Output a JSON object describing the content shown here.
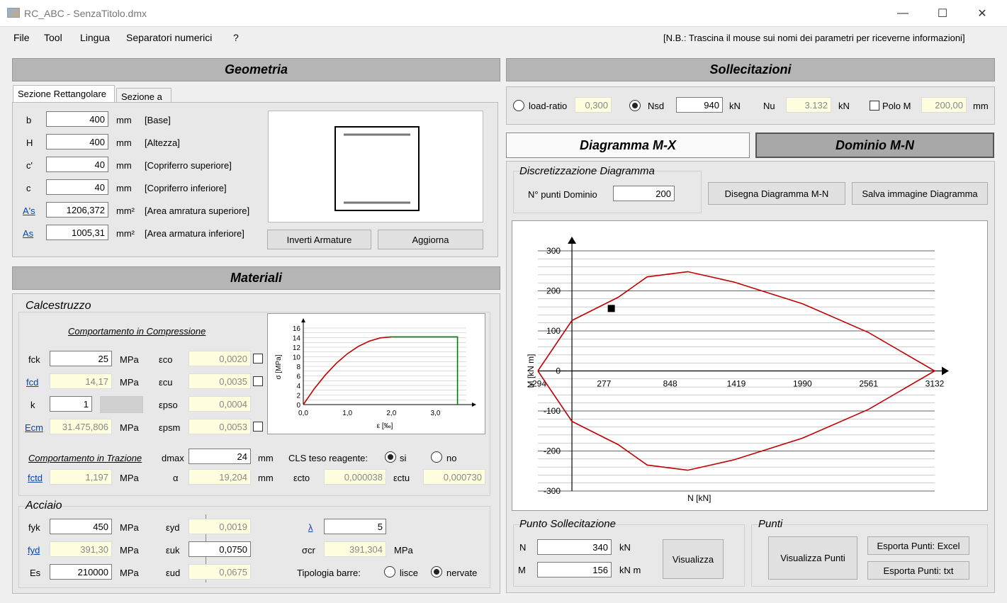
{
  "window": {
    "title": "RC_ABC - SenzaTitolo.dmx",
    "minimize": "—",
    "maximize": "☐",
    "close": "✕"
  },
  "menu": {
    "items": [
      "File",
      "Tool",
      "Lingua",
      "Separatori numerici",
      "?"
    ],
    "note": "[N.B.: Trascina il mouse sui nomi dei parametri per riceverne informazioni]"
  },
  "geometria": {
    "title": "Geometria",
    "tabs": [
      "Sezione Rettangolare",
      "Sezione a T"
    ],
    "rows": [
      {
        "label": "b",
        "value": "400",
        "unit": "mm",
        "desc": "[Base]",
        "link": false
      },
      {
        "label": "H",
        "value": "400",
        "unit": "mm",
        "desc": "[Altezza]",
        "link": false
      },
      {
        "label": "c'",
        "value": "40",
        "unit": "mm",
        "desc": "[Copriferro superiore]",
        "link": false
      },
      {
        "label": "c",
        "value": "40",
        "unit": "mm",
        "desc": "[Copriferro inferiore]",
        "link": false
      },
      {
        "label": "A's",
        "value": "1206,372",
        "unit": "mm²",
        "desc": "[Area amratura superiore]",
        "link": true
      },
      {
        "label": "As",
        "value": "1005,31",
        "unit": "mm²",
        "desc": "[Area armatura inferiore]",
        "link": true
      }
    ],
    "btn_inverti": "Inverti Armature",
    "btn_aggiorna": "Aggiorna"
  },
  "materiali": {
    "title": "Materiali",
    "calcestruzzo": "Calcestruzzo",
    "comp_title": "Comportamento in Compressione",
    "fck": {
      "label": "fck",
      "value": "25",
      "unit": "MPa"
    },
    "fcd": {
      "label": "fcd",
      "value": "14,17",
      "unit": "MPa"
    },
    "k": {
      "label": "k",
      "value": "1"
    },
    "ecm": {
      "label": "Ecm",
      "value": "31.475,806",
      "unit": "MPa"
    },
    "eco": {
      "label": "εco",
      "value": "0,0020"
    },
    "ecu": {
      "label": "εcu",
      "value": "0,0035"
    },
    "epso": {
      "label": "εpso",
      "value": "0,0004"
    },
    "epsm": {
      "label": "εpsm",
      "value": "0,0053"
    },
    "traz_title": "Comportamento in Trazione",
    "dmax": {
      "label": "dmax",
      "value": "24",
      "unit": "mm"
    },
    "cls_teso": {
      "label": "CLS teso reagente:",
      "si": "si",
      "no": "no"
    },
    "fctd": {
      "label": "fctd",
      "value": "1,197",
      "unit": "MPa"
    },
    "alpha": {
      "label": "α",
      "value": "19,204",
      "unit": "mm"
    },
    "ecto": {
      "label": "εcto",
      "value": "0,000038"
    },
    "ectu": {
      "label": "εctu",
      "value": "0,000730"
    },
    "acciaio": "Acciaio",
    "fyk": {
      "label": "fyk",
      "value": "450",
      "unit": "MPa"
    },
    "fyd": {
      "label": "fyd",
      "value": "391,30",
      "unit": "MPa"
    },
    "es": {
      "label": "Es",
      "value": "210000",
      "unit": "MPa"
    },
    "eyd": {
      "label": "εyd",
      "value": "0,0019"
    },
    "euk": {
      "label": "εuk",
      "value": "0,0750"
    },
    "eud": {
      "label": "εud",
      "value": "0,0675"
    },
    "lambda": {
      "label": "λ",
      "value": "5"
    },
    "scr": {
      "label": "σcr",
      "value": "391,304",
      "unit": "MPa"
    },
    "tipologia": {
      "label": "Tipologia barre:",
      "lisce": "lisce",
      "nervate": "nervate"
    }
  },
  "sollecitazioni": {
    "title": "Sollecitazioni",
    "load_ratio": {
      "label": "load-ratio",
      "value": "0,300"
    },
    "nsd": {
      "label": "Nsd",
      "value": "940",
      "unit": "kN"
    },
    "nu": {
      "label": "Nu",
      "value": "3.132",
      "unit": "kN"
    },
    "polo": {
      "label": "Polo M",
      "value": "200,00",
      "unit": "mm"
    }
  },
  "tabs2": {
    "mx": "Diagramma M-X",
    "mn": "Dominio M-N"
  },
  "discretizzazione": {
    "title": "Discretizzazione Diagramma",
    "punti_label": "N° punti Dominio",
    "punti_value": "200",
    "btn_disegna": "Disegna Diagramma M-N",
    "btn_salva": "Salva immagine Diagramma"
  },
  "punto": {
    "title": "Punto Sollecitazione",
    "n": {
      "label": "N",
      "value": "340",
      "unit": "kN"
    },
    "m": {
      "label": "M",
      "value": "156",
      "unit": "kN m"
    },
    "btn_visualizza": "Visualizza"
  },
  "punti": {
    "title": "Punti",
    "btn_visualizza": "Visualizza Punti",
    "btn_excel": "Esporta Punti: Excel",
    "btn_txt": "Esporta Punti: txt"
  },
  "chart_data": [
    {
      "type": "line",
      "title": "",
      "xlabel": "ε [‰]",
      "ylabel": "σ [MPa]",
      "xlim": [
        0,
        3.7
      ],
      "ylim": [
        0,
        16
      ],
      "x_ticks": [
        "0,0",
        "1,0",
        "2,0",
        "3,0"
      ],
      "y_ticks": [
        "0",
        "2",
        "4",
        "6",
        "8",
        "10",
        "12",
        "14",
        "16"
      ],
      "series": [
        {
          "color": "#c00000",
          "x": [
            0,
            0.25,
            0.5,
            0.75,
            1.0,
            1.25,
            1.5,
            1.75,
            2.0
          ],
          "y": [
            0,
            3.32,
            6.2,
            8.63,
            10.63,
            12.18,
            13.28,
            13.95,
            14.17
          ]
        },
        {
          "color": "#008000",
          "x": [
            2.0,
            3.5,
            3.5
          ],
          "y": [
            14.17,
            14.17,
            0
          ]
        }
      ]
    },
    {
      "type": "line",
      "title": "",
      "xlabel": "N [kN]",
      "ylabel": "M [kN m]",
      "xlim": [
        -294,
        3132
      ],
      "ylim": [
        -300,
        300
      ],
      "x_ticks": [
        "-294",
        "277",
        "848",
        "1419",
        "1990",
        "2561",
        "3132"
      ],
      "y_ticks": [
        "300",
        "200",
        "100",
        "0",
        "-100",
        "-200",
        "-300"
      ],
      "series": [
        {
          "color": "#c00000",
          "x": [
            -294,
            0,
            400,
            650,
            1000,
            1400,
            1990,
            2561,
            3132,
            2561,
            1990,
            1400,
            1000,
            650,
            400,
            0,
            -294
          ],
          "y": [
            0,
            126,
            184,
            235,
            248,
            222,
            168,
            96,
            0,
            -96,
            -168,
            -222,
            -248,
            -235,
            -184,
            -126,
            0
          ]
        }
      ],
      "point": {
        "N": 340,
        "M": 156
      }
    }
  ]
}
